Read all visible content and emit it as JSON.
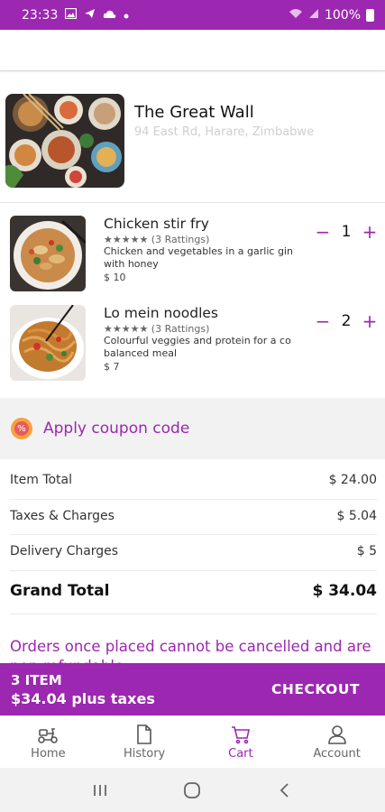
{
  "status_bar": {
    "time": "23:33",
    "battery": "100%",
    "icons": [
      "image-icon",
      "send-icon",
      "cloud-icon",
      "dot-icon",
      "wifi-icon",
      "signal-icon",
      "battery-icon"
    ]
  },
  "restaurant": {
    "name": "The Great Wall",
    "address": "94 East Rd, Harare, Zimbabwe"
  },
  "cart_items": [
    {
      "name": "Chicken stir fry",
      "rating": "★★★★★ (3 Rattings)",
      "description": "Chicken and vegetables in a garlic gin with honey",
      "price": "$ 10",
      "quantity": "1"
    },
    {
      "name": "Lo mein noodles",
      "rating": "★★★★★ (3 Rattings)",
      "description": "Colourful veggies and protein for a co balanced meal",
      "price": "$ 7",
      "quantity": "2"
    }
  ],
  "stepper": {
    "minus": "−",
    "plus": "+"
  },
  "coupon": {
    "label": "Apply coupon code",
    "icon_text": "%"
  },
  "bill": {
    "item_total_label": "Item Total",
    "item_total_value": "$ 24.00",
    "taxes_label": "Taxes & Charges",
    "taxes_value": "$ 5.04",
    "delivery_label": "Delivery Charges",
    "delivery_value": "$ 5",
    "grand_total_label": "Grand Total",
    "grand_total_value": "$ 34.04"
  },
  "notice": "Orders once placed cannot be cancelled and are non-refundable",
  "checkout": {
    "count": "3 ITEM",
    "total": "$34.04 plus taxes",
    "button": "CHECKOUT"
  },
  "bottom_nav": [
    {
      "label": "Home",
      "icon": "scooter-icon",
      "active": false
    },
    {
      "label": "History",
      "icon": "document-icon",
      "active": false
    },
    {
      "label": "Cart",
      "icon": "cart-icon",
      "active": true
    },
    {
      "label": "Account",
      "icon": "person-icon",
      "active": false
    }
  ],
  "colors": {
    "primary": "#9c27b0",
    "coupon_bg": "#f2f2f2",
    "address_gray": "#cfcfcf"
  }
}
